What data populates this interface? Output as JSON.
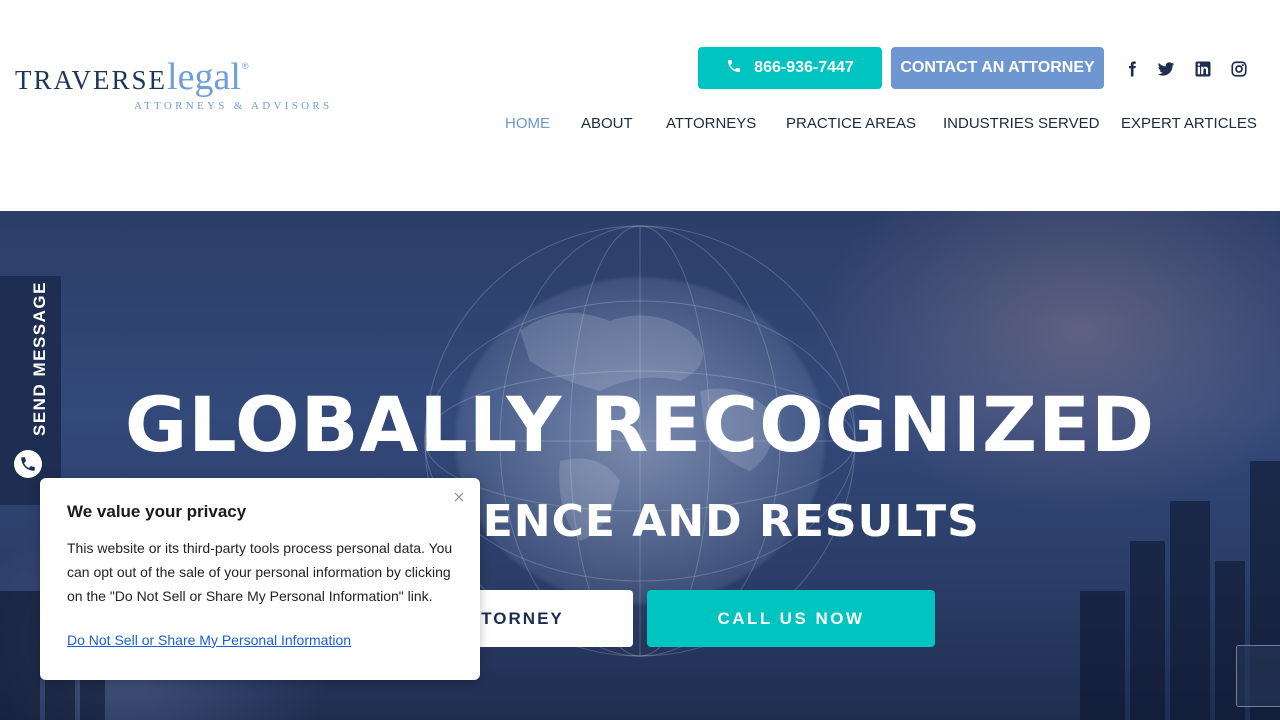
{
  "brand": {
    "logo_word1": "TRAVERSE",
    "logo_word2": "legal",
    "logo_reg": "®",
    "tagline": "ATTORNEYS & ADVISORS"
  },
  "header": {
    "phone_label": "866-936-7447",
    "contact_label": "CONTACT AN ATTORNEY",
    "social": [
      "facebook-icon",
      "twitter-icon",
      "linkedin-icon",
      "instagram-icon"
    ]
  },
  "nav": {
    "items": [
      {
        "label": "HOME",
        "active": true
      },
      {
        "label": "ABOUT",
        "active": false
      },
      {
        "label": "ATTORNEYS",
        "active": false
      },
      {
        "label": "PRACTICE AREAS",
        "active": false
      },
      {
        "label": "INDUSTRIES SERVED",
        "active": false
      },
      {
        "label": "EXPERT ARTICLES",
        "active": false
      }
    ]
  },
  "hero": {
    "title": "GLOBALLY RECOGNIZED",
    "subtitle": "EXPERIENCE AND RESULTS",
    "contact_button": "CONTACT AN ATTORNEY",
    "call_button": "CALL US NOW"
  },
  "side_tab": {
    "label": "SEND MESSAGE"
  },
  "privacy": {
    "title": "We value your privacy",
    "body": "This website or its third-party tools process personal data. You can opt out of the sale of your personal information by clicking on the \"Do Not Sell or Share My Personal Information\" link.",
    "link": "Do Not Sell or Share My Personal Information"
  },
  "colors": {
    "teal": "#00c4bf",
    "blue": "#6e96d0",
    "navy": "#1e2d52",
    "nav_text": "#1e2a3a"
  }
}
